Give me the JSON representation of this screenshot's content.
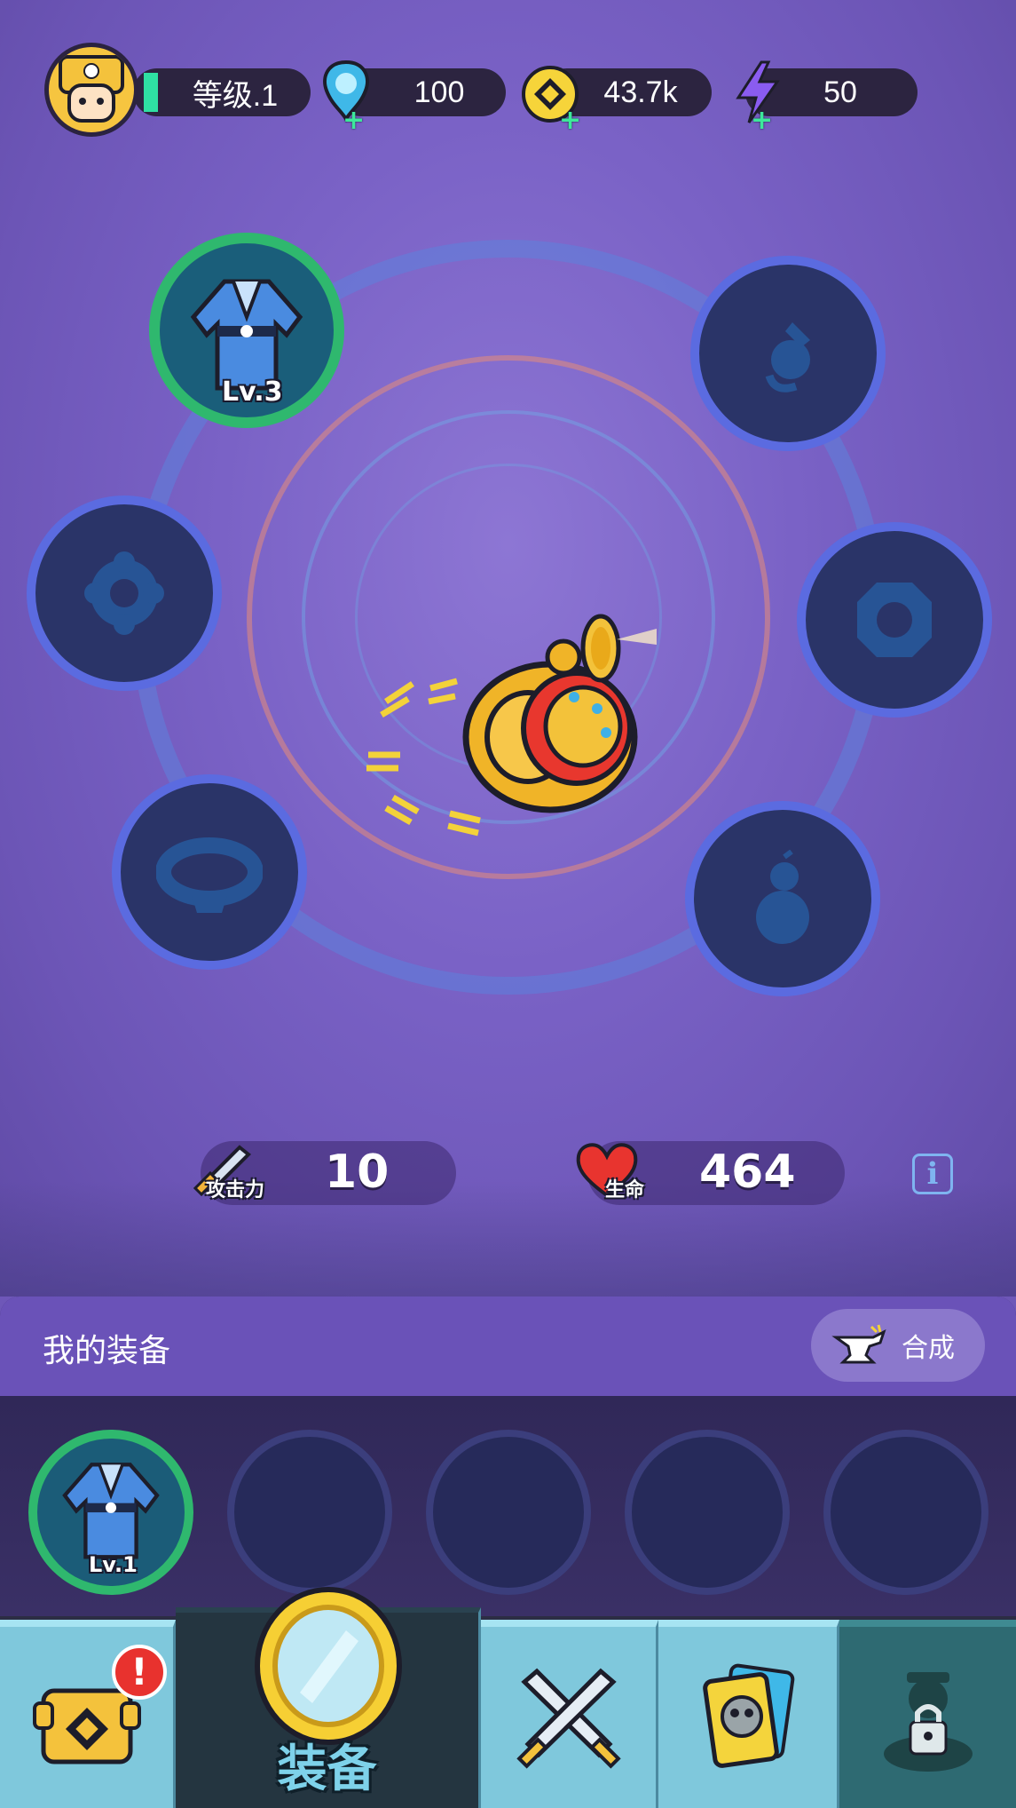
{
  "header": {
    "level_label": "等级.1",
    "gems": "100",
    "gold": "43.7k",
    "energy": "50"
  },
  "slots": {
    "robe_level": "Lv.3"
  },
  "stats": {
    "attack_label": "攻击力",
    "attack_value": "10",
    "hp_label": "生命",
    "hp_value": "464",
    "info_label": "i"
  },
  "equipment_panel": {
    "title": "我的装备",
    "synth_label": "合成",
    "items": [
      {
        "level": "Lv.1"
      }
    ]
  },
  "nav": {
    "active_label": "装备",
    "badge": "!"
  },
  "colors": {
    "background": "#7a62c6",
    "level_bar": "#2fe0a3",
    "equipped_ring": "#2fb86e",
    "empty_ring": "#5b6be0"
  }
}
